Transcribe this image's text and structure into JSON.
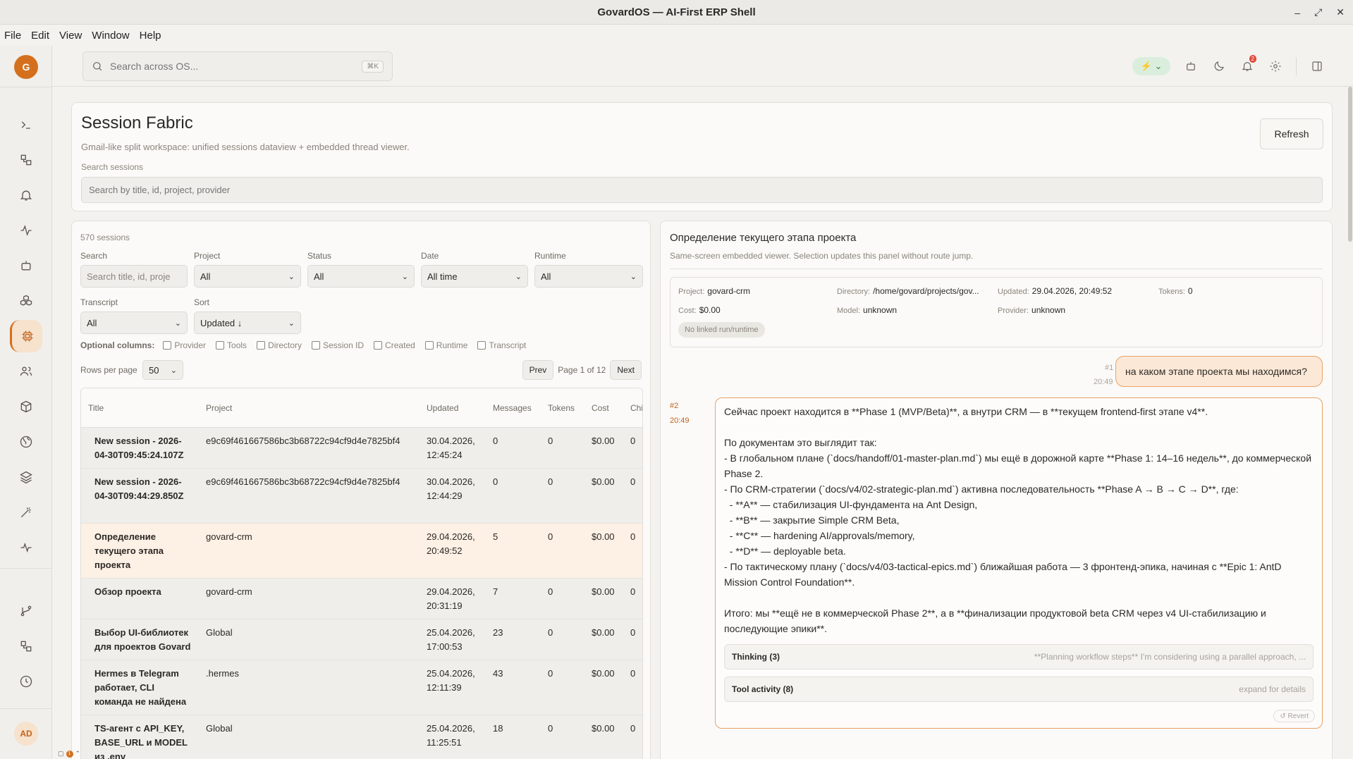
{
  "window": {
    "title": "GovardOS — AI-First ERP Shell",
    "min": "–",
    "max": "⤢",
    "close": "✕"
  },
  "menu": [
    "File",
    "Edit",
    "View",
    "Window",
    "Help"
  ],
  "rail": {
    "logo": "G",
    "avatar": "AD"
  },
  "topbar": {
    "search_placeholder": "Search across OS...",
    "shortcut": "⌘K",
    "bolt": "⚡ ⌄",
    "notif_badge": "2"
  },
  "header": {
    "title": "Session Fabric",
    "subtitle": "Gmail-like split workspace: unified sessions dataview + embedded thread viewer.",
    "search_label": "Search sessions",
    "search_placeholder": "Search by title, id, project, provider",
    "refresh": "Refresh"
  },
  "list": {
    "count": "570 sessions",
    "filters": {
      "search_label": "Search",
      "search_placeholder": "Search title, id, proje",
      "project_label": "Project",
      "project_value": "All",
      "status_label": "Status",
      "status_value": "All",
      "date_label": "Date",
      "date_value": "All time",
      "runtime_label": "Runtime",
      "runtime_value": "All",
      "transcript_label": "Transcript",
      "transcript_value": "All",
      "sort_label": "Sort",
      "sort_value": "Updated ↓"
    },
    "optional_label": "Optional columns:",
    "optional_columns": [
      "Provider",
      "Tools",
      "Directory",
      "Session ID",
      "Created",
      "Runtime",
      "Transcript"
    ],
    "rows_per_page_label": "Rows per page",
    "rows_per_page": "50",
    "pager": {
      "prev": "Prev",
      "page": "Page 1 of 12",
      "next": "Next"
    },
    "columns": [
      "Title",
      "Project",
      "Updated",
      "Messages",
      "Tokens",
      "Cost",
      "Chi"
    ],
    "rows": [
      {
        "title": "New session - 2026-04-30T09:45:24.107Z",
        "project": "e9c69f461667586bc3b68722c94cf9d4e7825bf4",
        "updated": "30.04.2026,\n12:45:24",
        "messages": "0",
        "tokens": "0",
        "cost": "$0.00",
        "ch": "0"
      },
      {
        "title": "New session - 2026-04-30T09:44:29.850Z",
        "project": "e9c69f461667586bc3b68722c94cf9d4e7825bf4",
        "updated": "30.04.2026,\n12:44:29",
        "messages": "0",
        "tokens": "0",
        "cost": "$0.00",
        "ch": "0"
      },
      {
        "title": "Определение текущего этапа проекта",
        "project": "govard-crm",
        "updated": "29.04.2026,\n20:49:52",
        "messages": "5",
        "tokens": "0",
        "cost": "$0.00",
        "ch": "0"
      },
      {
        "title": "Обзор проекта",
        "project": "govard-crm",
        "updated": "29.04.2026,\n20:31:19",
        "messages": "7",
        "tokens": "0",
        "cost": "$0.00",
        "ch": "0"
      },
      {
        "title": "Выбор UI-библиотек для проектов Govard",
        "project": "Global",
        "updated": "25.04.2026,\n17:00:53",
        "messages": "23",
        "tokens": "0",
        "cost": "$0.00",
        "ch": "0"
      },
      {
        "title": "Hermes в Telegram работает, CLI команда не найдена",
        "project": ".hermes",
        "updated": "25.04.2026,\n12:11:39",
        "messages": "43",
        "tokens": "0",
        "cost": "$0.00",
        "ch": "0"
      },
      {
        "title": "TS-агент с API_KEY, BASE_URL и MODEL из .env",
        "project": "Global",
        "updated": "25.04.2026,\n11:25:51",
        "messages": "18",
        "tokens": "0",
        "cost": "$0.00",
        "ch": "0"
      }
    ]
  },
  "viewer": {
    "title": "Определение текущего этапа проекта",
    "subtitle": "Same-screen embedded viewer. Selection updates this panel without route jump.",
    "meta": {
      "project_k": "Project:",
      "project": "govard-crm",
      "directory_k": "Directory:",
      "directory": "/home/govard/projects/gov...",
      "updated_k": "Updated:",
      "updated": "29.04.2026, 20:49:52",
      "tokens_k": "Tokens:",
      "tokens": "0",
      "cost_k": "Cost:",
      "cost": "$0.00",
      "model_k": "Model:",
      "model": "unknown",
      "provider_k": "Provider:",
      "provider": "unknown",
      "chip": "No linked run/runtime"
    },
    "user_msg": {
      "num": "#1",
      "time": "20:49",
      "text": "на каком этапе проекта мы находимся?"
    },
    "assistant_msg": {
      "num": "#2",
      "time": "20:49",
      "text": "Сейчас проект находится в **Phase 1 (MVP/Beta)**, а внутри CRM — в **текущем frontend-first этапе v4**.\n\nПо документам это выглядит так:\n- В глобальном плане (`docs/handoff/01-master-plan.md`) мы ещё в дорожной карте **Phase 1: 14–16 недель**, до коммерческой Phase 2.\n- По CRM-стратегии (`docs/v4/02-strategic-plan.md`) активна последовательность **Phase A → B → C → D**, где:\n  - **A** — стабилизация UI-фундамента на Ant Design,\n  - **B** — закрытие Simple CRM Beta,\n  - **C** — hardening AI/approvals/memory,\n  - **D** — deployable beta.\n- По тактическому плану (`docs/v4/03-tactical-epics.md`) ближайшая работа — 3 фронтенд-эпика, начиная с **Epic 1: AntD Mission Control Foundation**.\n\nИтого: мы **ещё не в коммерческой Phase 2**, а в **финализации продуктовой beta CRM через v4 UI-стабилизацию и последующие эпики**.",
      "thinking_label": "Thinking (3)",
      "thinking_hint": "**Planning workflow steps** I'm considering using a parallel approach, ...",
      "tools_label": "Tool activity (8)",
      "tools_hint": "expand for details",
      "revert": "↺ Revert"
    }
  },
  "tray": {
    "badge": "1"
  }
}
